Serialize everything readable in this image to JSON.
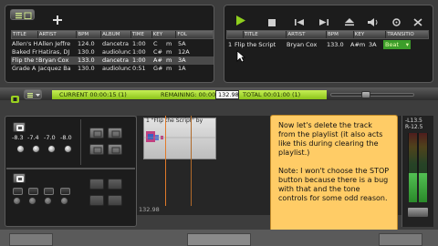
{
  "library": {
    "columns": [
      "TITLE",
      "ARTIST",
      "BPM",
      "ALBUM",
      "TIME",
      "KEY",
      "FOL"
    ],
    "rows": [
      [
        "Allen's Hou",
        "Allen Jeffre",
        "124.0",
        "dancetra",
        "1:00",
        "C",
        "m",
        "5A"
      ],
      [
        "Baked From",
        "Hatiras, DJ",
        "130.0",
        "audiolunc",
        "1:00",
        "C#",
        "m",
        "12A"
      ],
      [
        "Flip the Scri",
        "Bryan Cox",
        "133.0",
        "dancetra",
        "1:00",
        "A#",
        "m",
        "3A"
      ],
      [
        "Grade A Bit",
        "Jacquez Ba",
        "130.0",
        "audiolunc",
        "0:51",
        "G#",
        "m",
        "1A"
      ]
    ],
    "selected_row": 2
  },
  "playlist": {
    "columns": [
      "TITLE",
      "ARTIST",
      "BPM",
      "KEY",
      "TRANSITIO"
    ],
    "row": {
      "num": "1",
      "title": "Flip the Script",
      "artist": "Bryan Cox",
      "bpm": "133.0",
      "key": "A#m",
      "keynum": "3A",
      "transition": "Beat"
    }
  },
  "timeline": {
    "current": "CURRENT 00:00:15 (1)",
    "remaining": "REMAINING: 00:00:4",
    "bpm_box": "132.98",
    "total": "TOTAL 00:01:00 (1)",
    "clip_title": "1  \"Flip the Script\" by",
    "marker_label": "132.98"
  },
  "eq": {
    "values": [
      "-8.3",
      "-7.4",
      "-7.0",
      "-8.0"
    ]
  },
  "meter": {
    "top": "-L13.5",
    "bottom": "R-12.5"
  },
  "note": {
    "paragraph1": "Now let's delete the track from the playlist (it also acts like this during clearing the playlist.)",
    "paragraph2": "Note: I won't choose the STOP button because there is a bug with that and the tone controls for some odd reason."
  },
  "colors": {
    "accent_green": "#9ad021",
    "note_bg": "#ffcc66",
    "playhead": "#e07a2a"
  }
}
